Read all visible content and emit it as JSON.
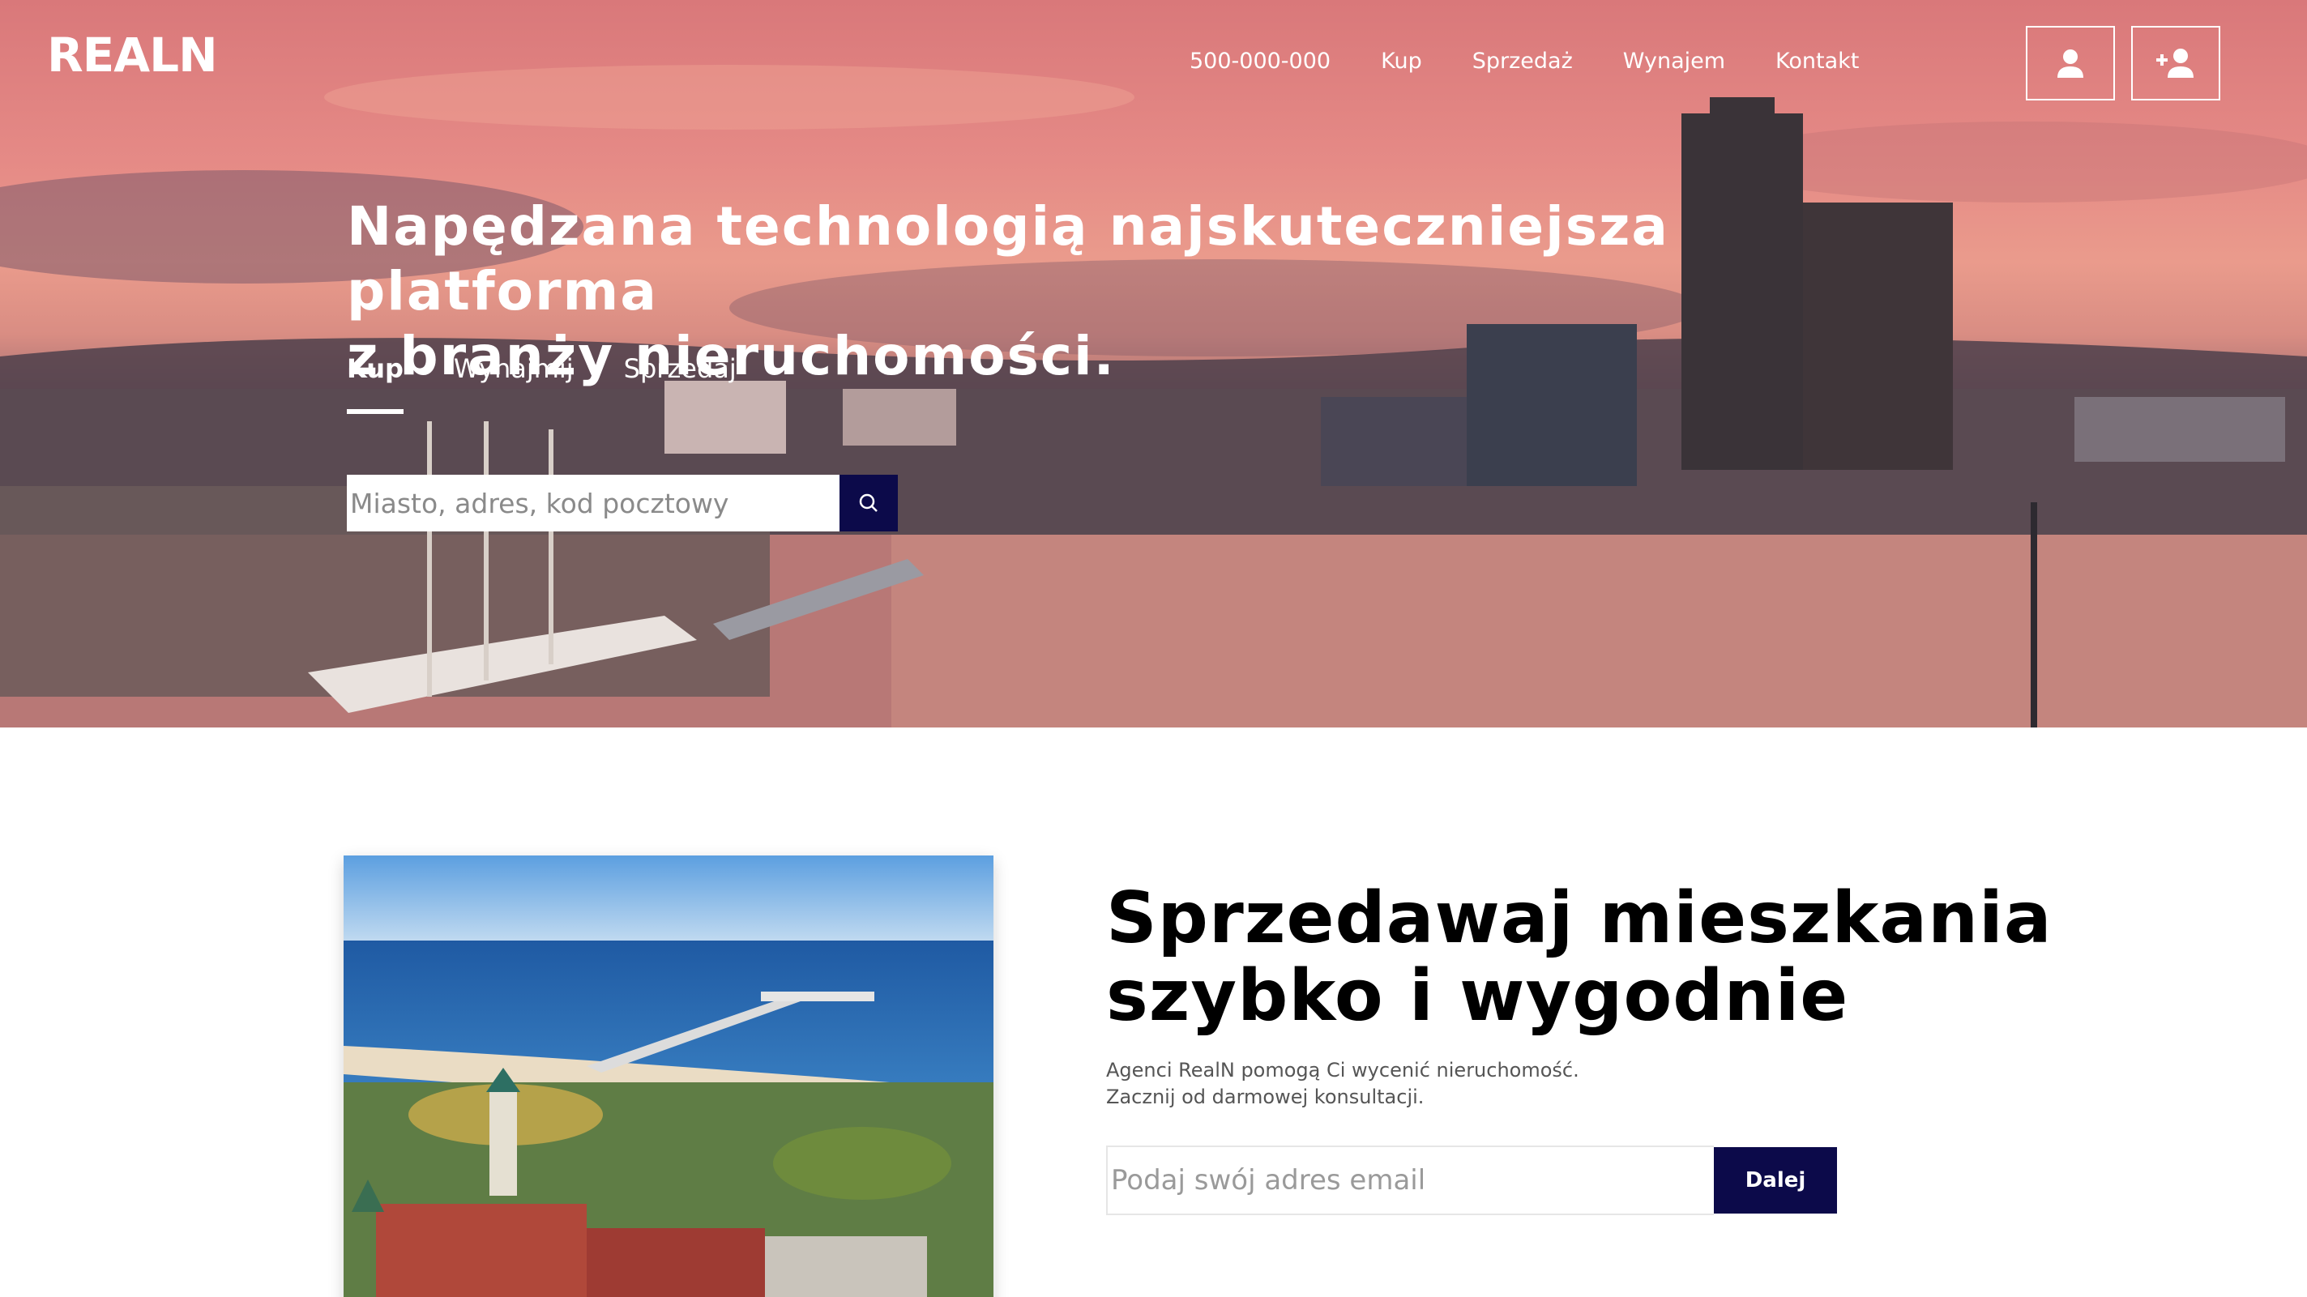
{
  "brand": {
    "logo_text": "REALN"
  },
  "nav": {
    "phone": "500-000-000",
    "items": [
      "Kup",
      "Sprzedaż",
      "Wynajem",
      "Kontakt"
    ]
  },
  "header_icons": {
    "login": "user-icon",
    "register": "user-plus-icon"
  },
  "hero": {
    "headline_line1": "Napędzana technologią najskuteczniejsza platforma",
    "headline_line2": "z branży nieruchomości.",
    "modes": [
      "Kup",
      "Wynajmij",
      "Sprzedaj"
    ],
    "active_mode": "Kup",
    "search_placeholder": "Miasto, adres, kod pocztowy",
    "search_icon": "search-icon"
  },
  "sell": {
    "title_line1": "Sprzedawaj mieszkania",
    "title_line2": "szybko i wygodnie",
    "desc_line1": "Agenci RealN pomogą Ci wycenić nieruchomość.",
    "desc_line2": "Zacznij od darmowej konsultacji.",
    "email_placeholder": "Podaj swój adres email",
    "button_label": "Dalej"
  },
  "colors": {
    "accent": "#0c0a4a",
    "hero_sky": "#e58a86",
    "text_dark": "#000000",
    "text_muted": "#555555"
  }
}
